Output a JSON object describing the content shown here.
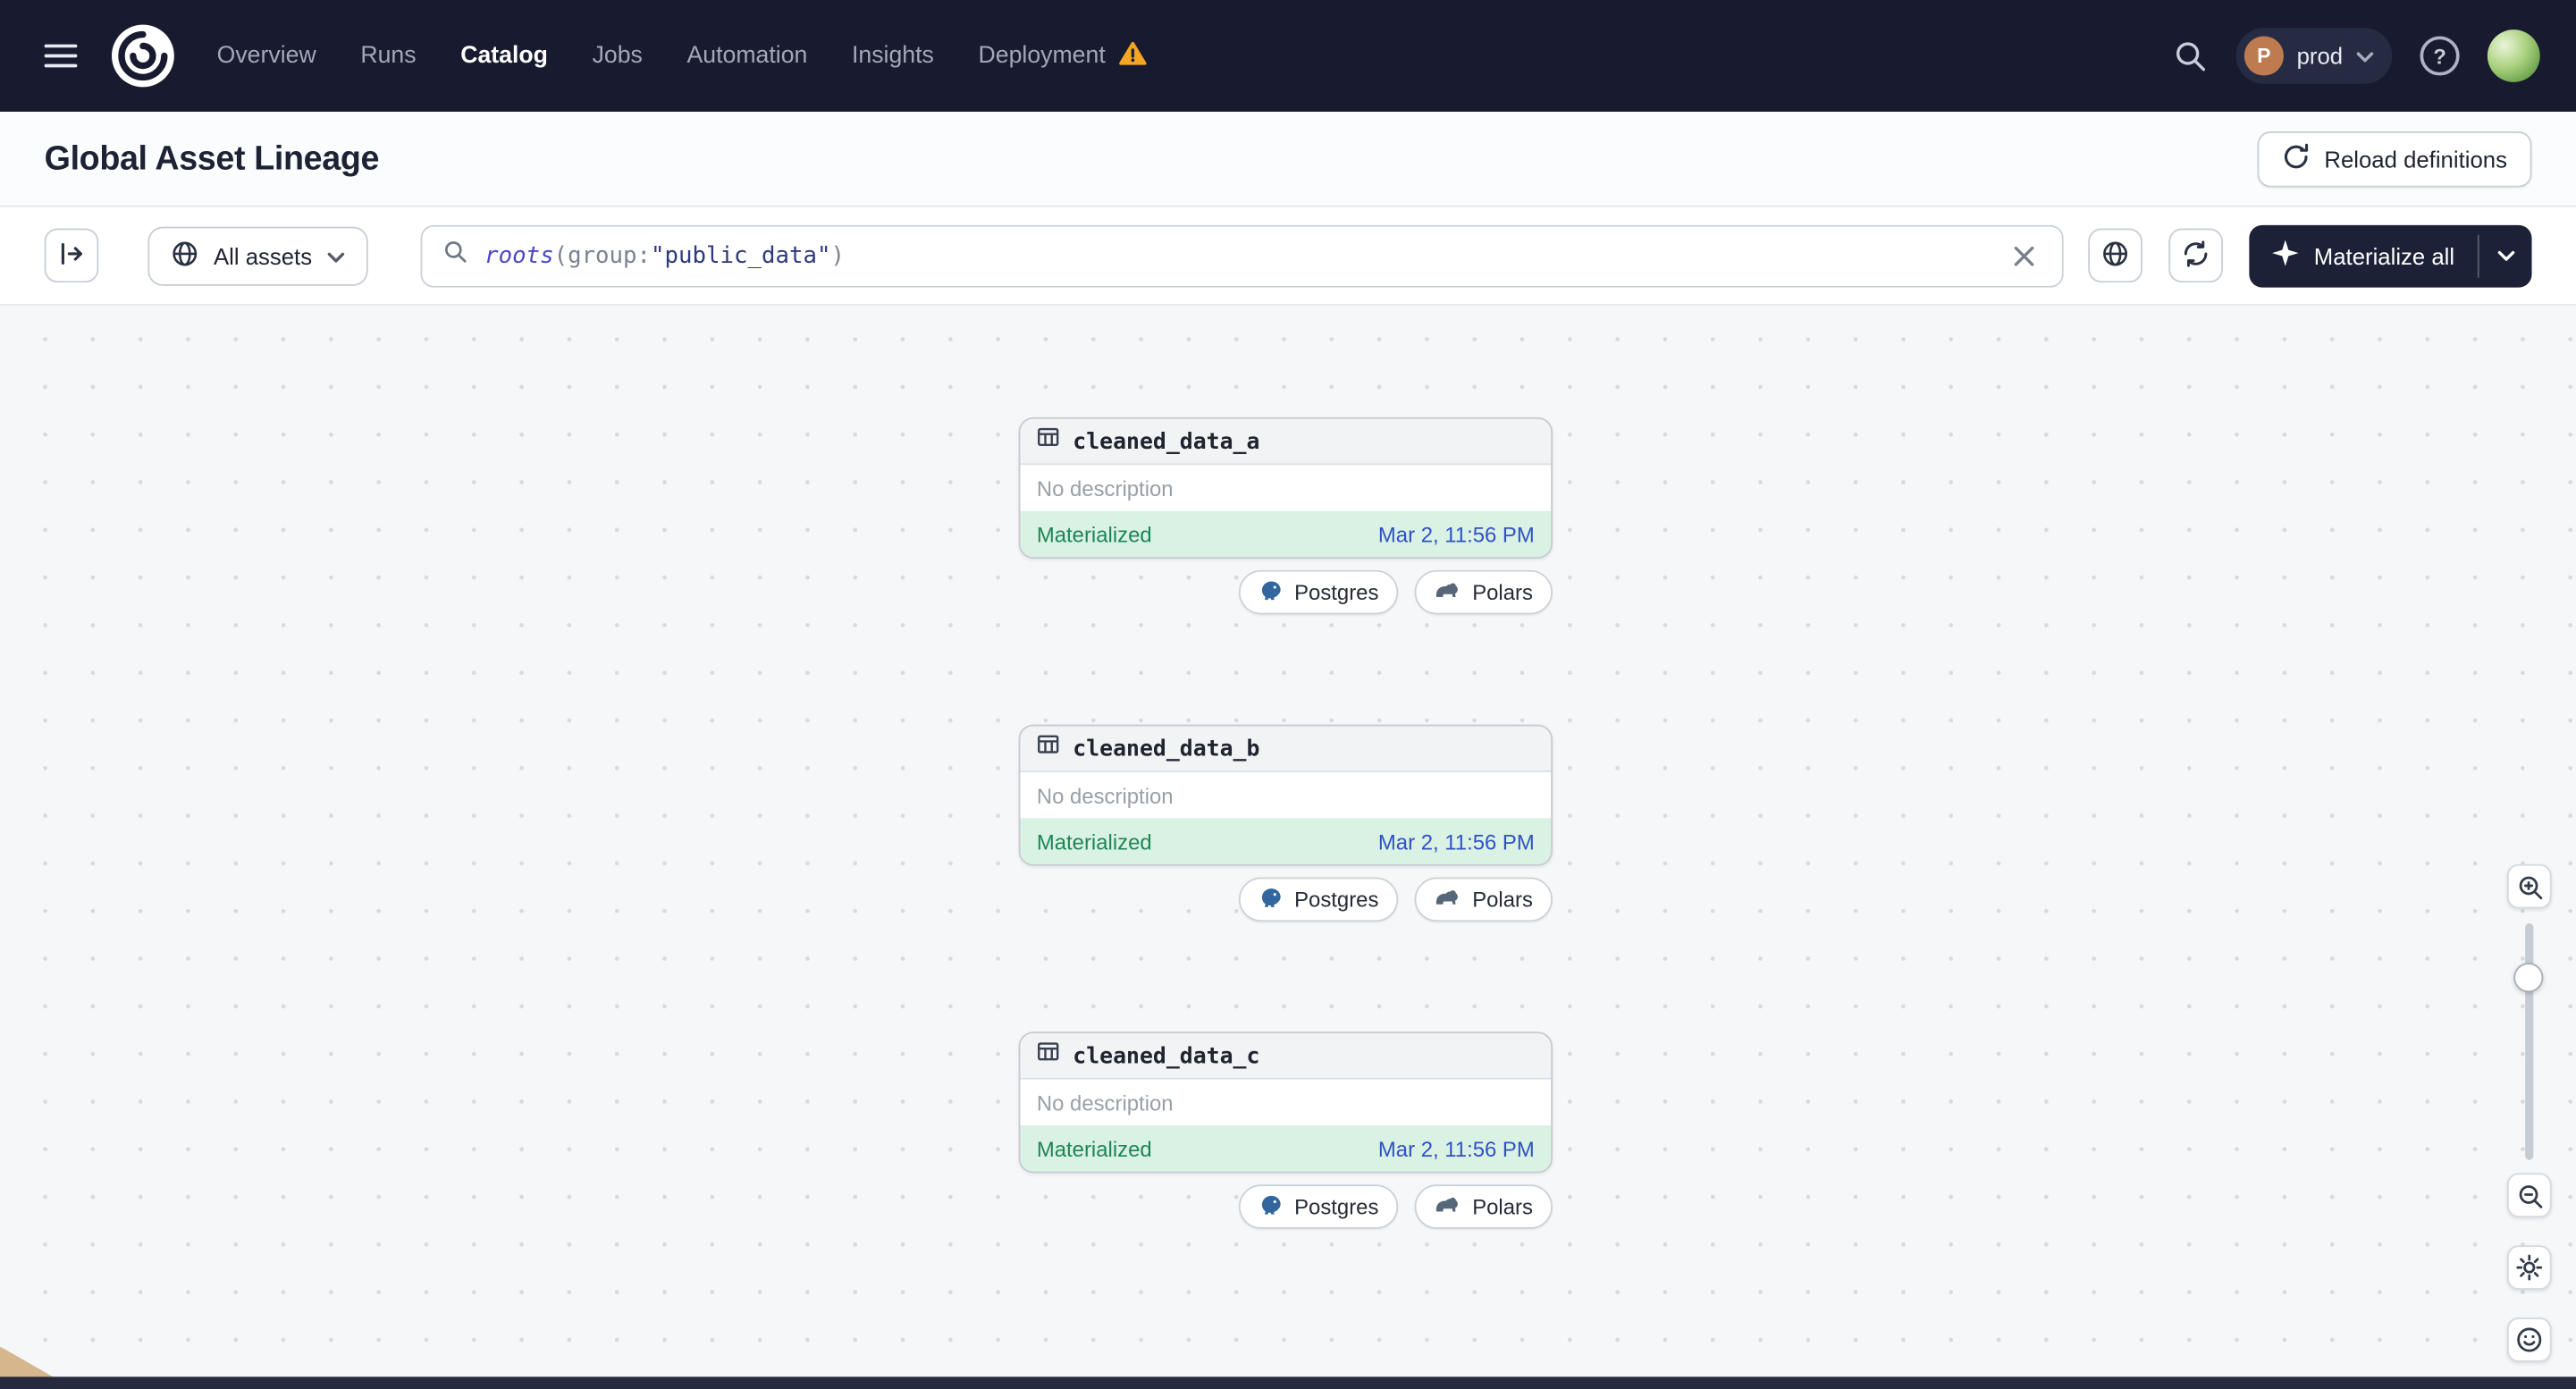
{
  "nav": {
    "items": [
      {
        "label": "Overview"
      },
      {
        "label": "Runs"
      },
      {
        "label": "Catalog"
      },
      {
        "label": "Jobs"
      },
      {
        "label": "Automation"
      },
      {
        "label": "Insights"
      },
      {
        "label": "Deployment"
      }
    ],
    "active_item": "Catalog",
    "deployment_has_warning": true,
    "env": {
      "initial": "P",
      "name": "prod"
    },
    "help_glyph": "?"
  },
  "header": {
    "title": "Global Asset Lineage",
    "reload_label": "Reload definitions"
  },
  "toolbar": {
    "filter_label": "All assets",
    "query": {
      "fn": "roots",
      "open_punct": "(group:",
      "value": "\"public_data\"",
      "close_punct": ")"
    },
    "materialize_label": "Materialize all"
  },
  "graph": {
    "nodes": [
      {
        "name": "cleaned_data_a",
        "description": "No description",
        "status": "Materialized",
        "timestamp": "Mar 2, 11:56 PM",
        "tags": [
          {
            "label": "Postgres"
          },
          {
            "label": "Polars"
          }
        ]
      },
      {
        "name": "cleaned_data_b",
        "description": "No description",
        "status": "Materialized",
        "timestamp": "Mar 2, 11:56 PM",
        "tags": [
          {
            "label": "Postgres"
          },
          {
            "label": "Polars"
          }
        ]
      },
      {
        "name": "cleaned_data_c",
        "description": "No description",
        "status": "Materialized",
        "timestamp": "Mar 2, 11:56 PM",
        "tags": [
          {
            "label": "Postgres"
          },
          {
            "label": "Polars"
          }
        ]
      }
    ]
  },
  "icons": {
    "menu-icon": "hamburger",
    "dagster-logo": "nautilus-swirl",
    "warning-icon": "orange-triangle-exclamation",
    "search-icon": "magnifier",
    "chevron-down-icon": "chevron-down",
    "help-icon": "question-circle",
    "avatar": "green-profile-photo",
    "reload-definitions-icon": "circular-arrow",
    "panel-toggle-icon": "expand-panel-right",
    "globe-icon": "globe",
    "clear-icon": "x-cross",
    "refresh-icon": "sync-arrows",
    "sparkle-icon": "four-point-star",
    "table-icon": "table-grid",
    "postgres-icon": "elephant",
    "polars-icon": "polar-bear",
    "zoom-in-icon": "magnifier-plus",
    "zoom-out-icon": "magnifier-minus",
    "settings-icon": "gear",
    "feedback-icon": "smiley-face"
  },
  "colors": {
    "nav_bg": "#181B2F",
    "warning": "#F5A623",
    "materialized_bg": "#D9F2E3",
    "materialized_text": "#1E8656",
    "timestamp_link": "#3151C6",
    "canvas_bg": "#F5F7F8",
    "dark_button": "#1C2138",
    "env_badge": "#BD7B4F"
  }
}
